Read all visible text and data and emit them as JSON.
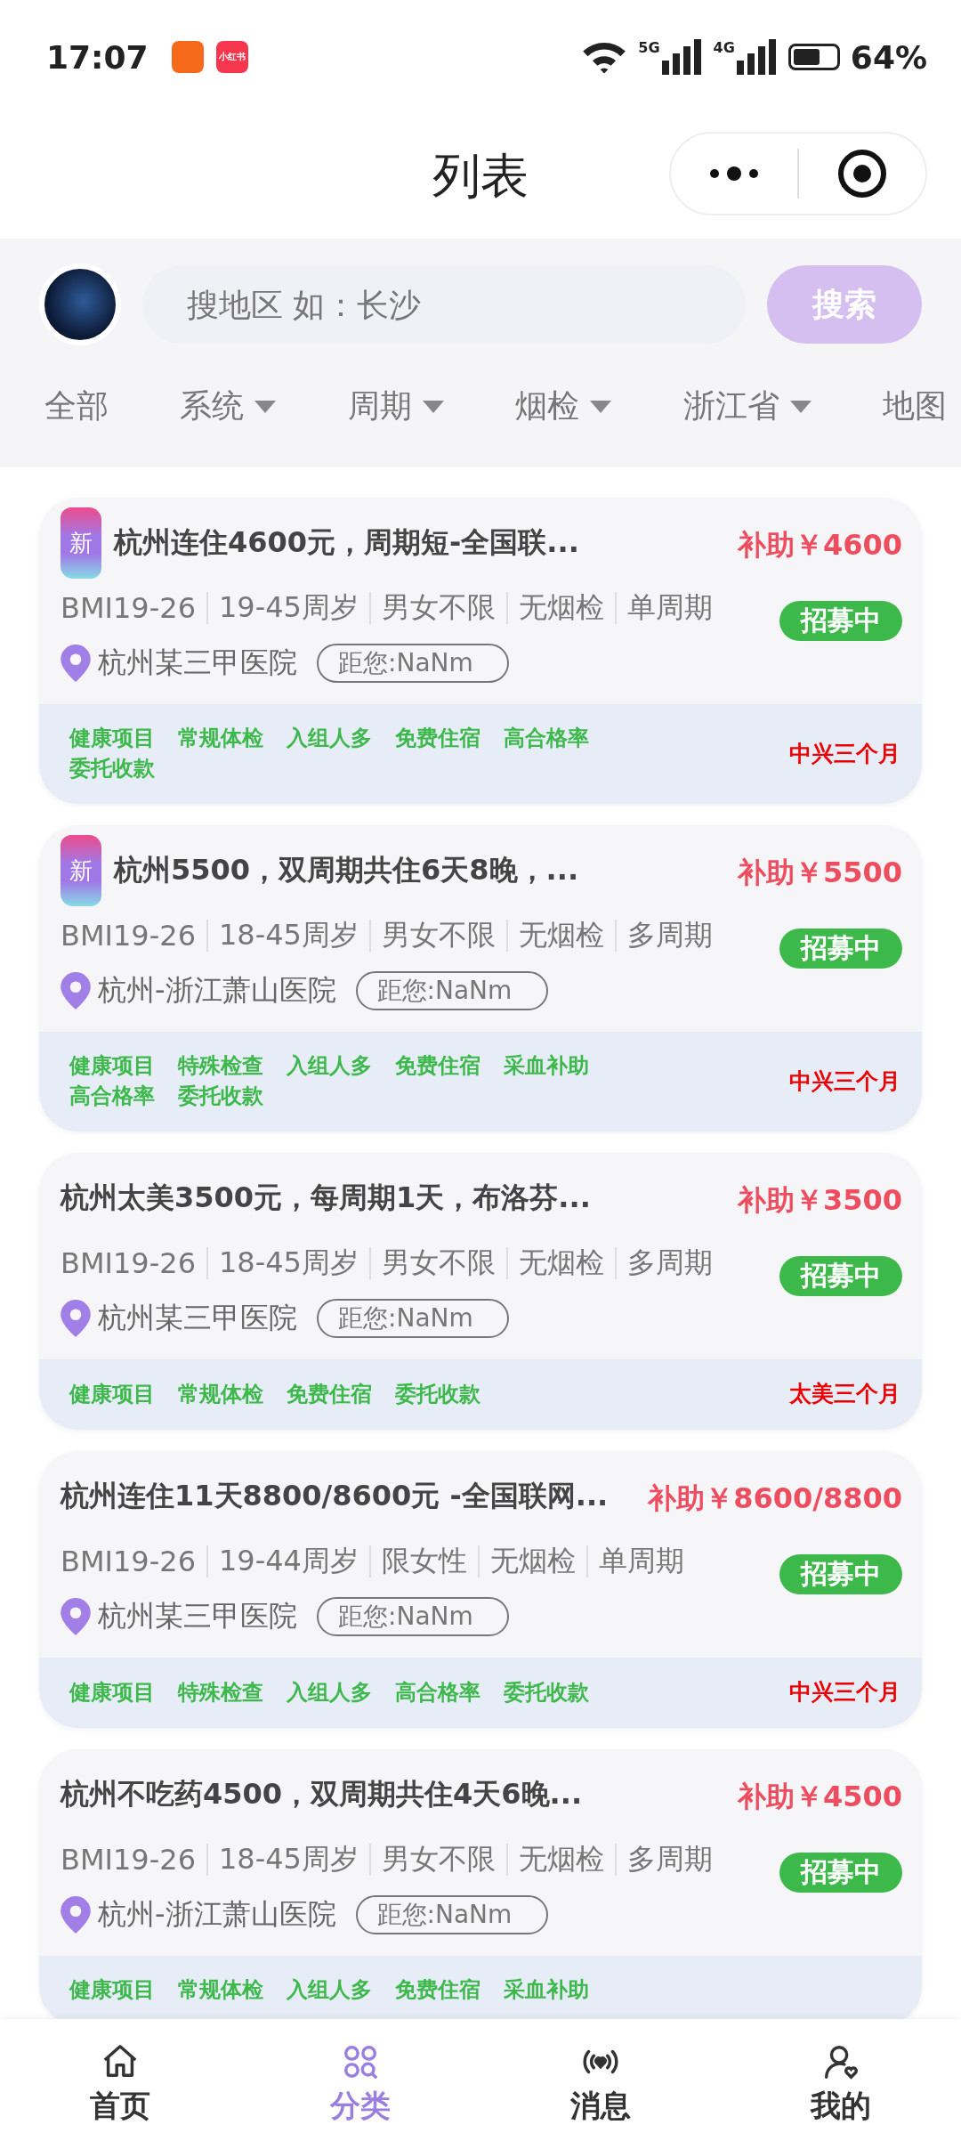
{
  "status_bar": {
    "time": "17:07",
    "app_badge": "小红书",
    "network_1": "5G",
    "network_2": "4G",
    "battery": "64%"
  },
  "header": {
    "title": "列表"
  },
  "search": {
    "placeholder": "搜地区 如：长沙",
    "button": "搜索"
  },
  "filters": [
    {
      "label": "全部",
      "dropdown": false
    },
    {
      "label": "系统",
      "dropdown": true
    },
    {
      "label": "周期",
      "dropdown": true
    },
    {
      "label": "烟检",
      "dropdown": true
    },
    {
      "label": "浙江省",
      "dropdown": true
    },
    {
      "label": "地图",
      "dropdown": false
    }
  ],
  "cards": [
    {
      "new_badge": "新",
      "title": "杭州连住4600元，周期短-全国联...",
      "subsidy": "补助￥4600",
      "attributes": [
        "BMI19-26",
        "19-45周岁",
        "男女不限",
        "无烟检",
        "单周期"
      ],
      "status": "招募中",
      "location": "杭州某三甲医院",
      "distance": "距您:NaNm",
      "tags": [
        "健康项目",
        "常规体检",
        "入组人多",
        "免费住宿",
        "高合格率",
        "委托收款"
      ],
      "provider": "中兴三个月"
    },
    {
      "new_badge": "新",
      "title": "杭州5500，双周期共住6天8晚，...",
      "subsidy": "补助￥5500",
      "attributes": [
        "BMI19-26",
        "18-45周岁",
        "男女不限",
        "无烟检",
        "多周期"
      ],
      "status": "招募中",
      "location": "杭州-浙江萧山医院",
      "distance": "距您:NaNm",
      "tags": [
        "健康项目",
        "特殊检查",
        "入组人多",
        "免费住宿",
        "采血补助",
        "高合格率",
        "委托收款"
      ],
      "provider": "中兴三个月"
    },
    {
      "title": "杭州太美3500元，每周期1天，布洛芬...",
      "subsidy": "补助￥3500",
      "attributes": [
        "BMI19-26",
        "18-45周岁",
        "男女不限",
        "无烟检",
        "多周期"
      ],
      "status": "招募中",
      "location": "杭州某三甲医院",
      "distance": "距您:NaNm",
      "tags": [
        "健康项目",
        "常规体检",
        "免费住宿",
        "委托收款"
      ],
      "provider": "太美三个月"
    },
    {
      "title": "杭州连住11天8800/8600元 -全国联网...",
      "subsidy": "补助￥8600/8800",
      "attributes": [
        "BMI19-26",
        "19-44周岁",
        "限女性",
        "无烟检",
        "单周期"
      ],
      "status": "招募中",
      "location": "杭州某三甲医院",
      "distance": "距您:NaNm",
      "tags": [
        "健康项目",
        "特殊检查",
        "入组人多",
        "高合格率",
        "委托收款"
      ],
      "provider": "中兴三个月"
    },
    {
      "title": "杭州不吃药4500，双周期共住4天6晚...",
      "subsidy": "补助￥4500",
      "attributes": [
        "BMI19-26",
        "18-45周岁",
        "男女不限",
        "无烟检",
        "多周期"
      ],
      "status": "招募中",
      "location": "杭州-浙江萧山医院",
      "distance": "距您:NaNm",
      "tags": [
        "健康项目",
        "常规体检",
        "入组人多",
        "免费住宿",
        "采血补助"
      ]
    }
  ],
  "tab_bar": [
    {
      "label": "首页",
      "kind": "home",
      "selected": false
    },
    {
      "label": "分类",
      "kind": "category",
      "selected": true
    },
    {
      "label": "消息",
      "kind": "message",
      "selected": false
    },
    {
      "label": "我的",
      "kind": "profile",
      "selected": false
    }
  ]
}
